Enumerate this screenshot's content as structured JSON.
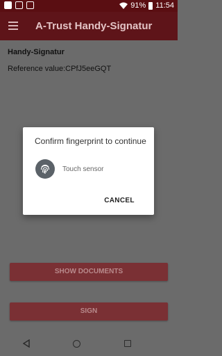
{
  "status_bar": {
    "battery_percent": "91%",
    "time": "11:54"
  },
  "app_bar": {
    "title": "A-Trust Handy-Signatur"
  },
  "content": {
    "title": "Handy-Signatur",
    "reference": "Reference value:CPfJ5eeGQT"
  },
  "buttons": {
    "show_documents": "SHOW DOCUMENTS",
    "sign": "SIGN"
  },
  "dialog": {
    "title": "Confirm fingerprint to continue",
    "sensor_label": "Touch sensor",
    "cancel": "CANCEL"
  },
  "colors": {
    "brand": "#5e1419",
    "scrim": "#6b6b6b"
  }
}
